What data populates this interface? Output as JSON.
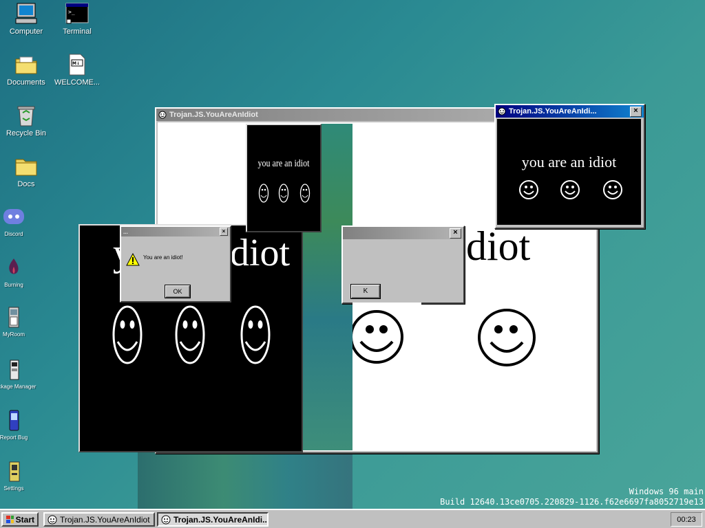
{
  "desktop": {
    "icons": [
      {
        "label": "Computer"
      },
      {
        "label": "Terminal"
      },
      {
        "label": "Documents"
      },
      {
        "label": "WELCOME..."
      },
      {
        "label": "Recycle Bin"
      },
      {
        "label": "Docs"
      },
      {
        "label": "Discord"
      },
      {
        "label": "Burning"
      },
      {
        "label": "MyRoom"
      },
      {
        "label": "Package Manager"
      },
      {
        "label": "Report Bug"
      },
      {
        "label": "Settings"
      }
    ]
  },
  "windows": {
    "main": {
      "title": "Trojan.JS.YouAreAnIdiot",
      "big_text": "diot"
    },
    "popup_right": {
      "title": "Trojan.JS.YouAreAnIdi...",
      "text": "you are an idiot"
    },
    "popup_small": {
      "text": "you are an idiot"
    },
    "black_left": {
      "big_text": "y",
      "big_text2": "diot"
    },
    "alert_small": {
      "title": "...",
      "message": "You are an idiot!",
      "ok": "OK"
    },
    "alert_mid": {
      "ok": "K"
    }
  },
  "colors": {
    "desktop_teal": "#2a8a92",
    "title_active": "#000080",
    "title_inactive": "#808080"
  },
  "watermark": {
    "line1": "Windows 96 main",
    "line2": "Build 12640.13ce0705.220829-1126.f62e6697fa8052719e13"
  },
  "taskbar": {
    "start_label": "Start",
    "tasks": [
      {
        "label": "Trojan.JS.YouAreAnIdiot"
      },
      {
        "label": "Trojan.JS.YouAreAnIdi..."
      }
    ],
    "clock": "00:23"
  }
}
